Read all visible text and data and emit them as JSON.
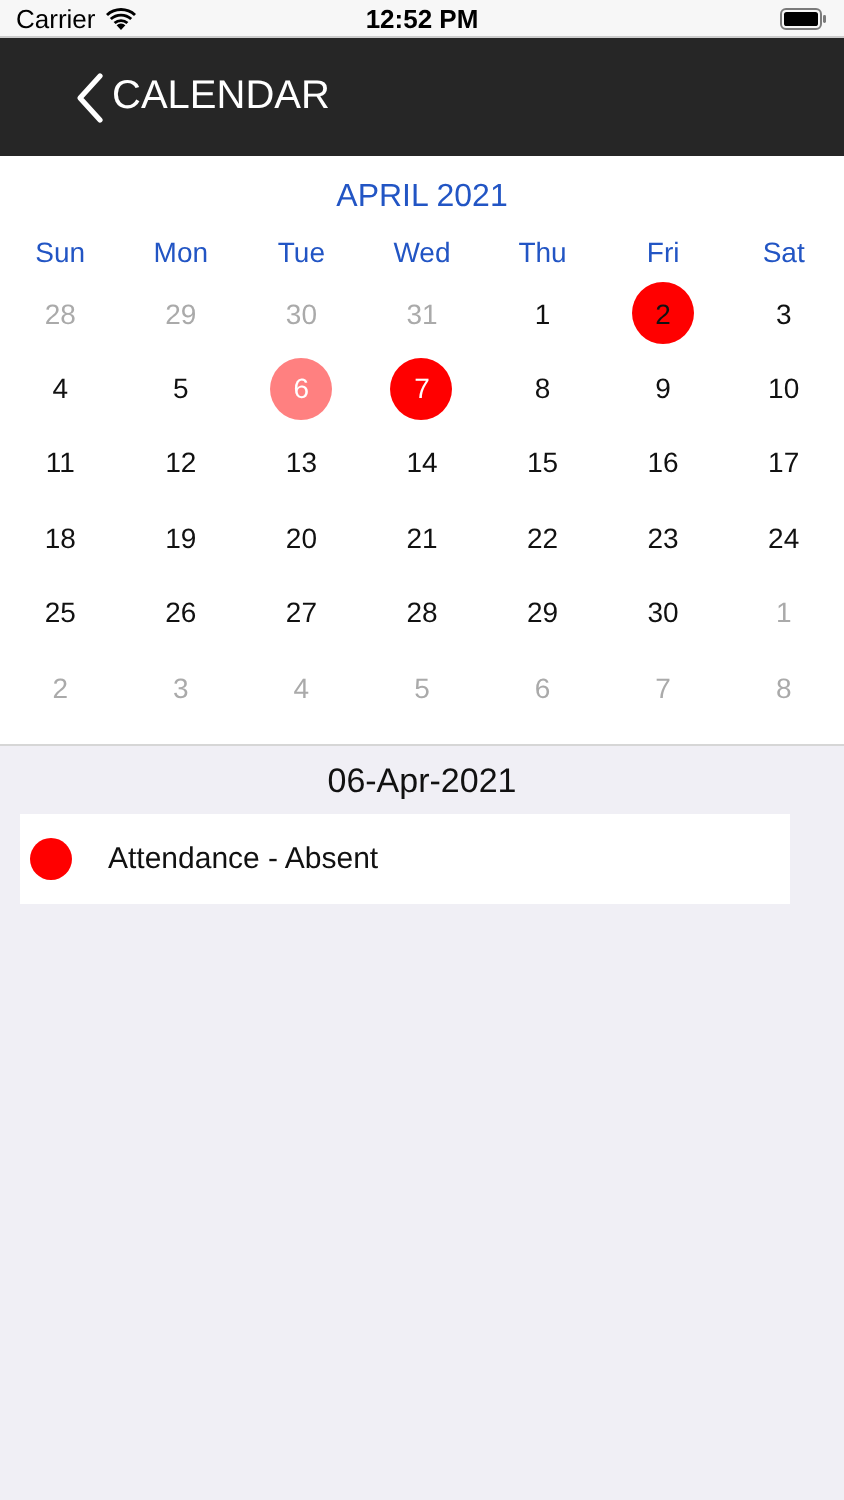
{
  "status_bar": {
    "carrier": "Carrier",
    "time": "12:52 PM"
  },
  "nav": {
    "title": "CALENDAR"
  },
  "calendar": {
    "month": "APRIL 2021",
    "weekdays": [
      "Sun",
      "Mon",
      "Tue",
      "Wed",
      "Thu",
      "Fri",
      "Sat"
    ],
    "weeks": [
      [
        {
          "day": "28",
          "kind": "plain",
          "in_month": false,
          "selected": false
        },
        {
          "day": "29",
          "kind": "plain",
          "in_month": false,
          "selected": false
        },
        {
          "day": "30",
          "kind": "plain",
          "in_month": false,
          "selected": false
        },
        {
          "day": "31",
          "kind": "plain",
          "in_month": false,
          "selected": false
        },
        {
          "day": "1",
          "kind": "plain",
          "in_month": true,
          "selected": false
        },
        {
          "day": "2",
          "kind": "today",
          "in_month": true,
          "selected": false,
          "color": "#ff0000"
        },
        {
          "day": "3",
          "kind": "plain",
          "in_month": true,
          "selected": false
        }
      ],
      [
        {
          "day": "4",
          "kind": "plain",
          "in_month": true,
          "selected": false
        },
        {
          "day": "5",
          "kind": "plain",
          "in_month": true,
          "selected": false
        },
        {
          "day": "6",
          "kind": "plain",
          "in_month": true,
          "selected": true
        },
        {
          "day": "7",
          "kind": "event",
          "in_month": true,
          "selected": false,
          "color": "#ff0000"
        },
        {
          "day": "8",
          "kind": "plain",
          "in_month": true,
          "selected": false
        },
        {
          "day": "9",
          "kind": "plain",
          "in_month": true,
          "selected": false
        },
        {
          "day": "10",
          "kind": "plain",
          "in_month": true,
          "selected": false
        }
      ],
      [
        {
          "day": "11",
          "kind": "plain",
          "in_month": true,
          "selected": false
        },
        {
          "day": "12",
          "kind": "plain",
          "in_month": true,
          "selected": false
        },
        {
          "day": "13",
          "kind": "plain",
          "in_month": true,
          "selected": false
        },
        {
          "day": "14",
          "kind": "plain",
          "in_month": true,
          "selected": false
        },
        {
          "day": "15",
          "kind": "plain",
          "in_month": true,
          "selected": false
        },
        {
          "day": "16",
          "kind": "plain",
          "in_month": true,
          "selected": false
        },
        {
          "day": "17",
          "kind": "plain",
          "in_month": true,
          "selected": false
        }
      ],
      [
        {
          "day": "18",
          "kind": "plain",
          "in_month": true,
          "selected": false
        },
        {
          "day": "19",
          "kind": "plain",
          "in_month": true,
          "selected": false
        },
        {
          "day": "20",
          "kind": "plain",
          "in_month": true,
          "selected": false
        },
        {
          "day": "21",
          "kind": "plain",
          "in_month": true,
          "selected": false
        },
        {
          "day": "22",
          "kind": "plain",
          "in_month": true,
          "selected": false
        },
        {
          "day": "23",
          "kind": "plain",
          "in_month": true,
          "selected": false
        },
        {
          "day": "24",
          "kind": "plain",
          "in_month": true,
          "selected": false
        }
      ],
      [
        {
          "day": "25",
          "kind": "plain",
          "in_month": true,
          "selected": false
        },
        {
          "day": "26",
          "kind": "plain",
          "in_month": true,
          "selected": false
        },
        {
          "day": "27",
          "kind": "plain",
          "in_month": true,
          "selected": false
        },
        {
          "day": "28",
          "kind": "plain",
          "in_month": true,
          "selected": false
        },
        {
          "day": "29",
          "kind": "plain",
          "in_month": true,
          "selected": false
        },
        {
          "day": "30",
          "kind": "plain",
          "in_month": true,
          "selected": false
        },
        {
          "day": "1",
          "kind": "plain",
          "in_month": false,
          "selected": false
        }
      ],
      [
        {
          "day": "2",
          "kind": "plain",
          "in_month": false,
          "selected": false
        },
        {
          "day": "3",
          "kind": "plain",
          "in_month": false,
          "selected": false
        },
        {
          "day": "4",
          "kind": "plain",
          "in_month": false,
          "selected": false
        },
        {
          "day": "5",
          "kind": "plain",
          "in_month": false,
          "selected": false
        },
        {
          "day": "6",
          "kind": "plain",
          "in_month": false,
          "selected": false
        },
        {
          "day": "7",
          "kind": "plain",
          "in_month": false,
          "selected": false
        },
        {
          "day": "8",
          "kind": "plain",
          "in_month": false,
          "selected": false
        }
      ]
    ]
  },
  "selected_date": "06-Apr-2021",
  "events": [
    {
      "title": "Attendance - Absent",
      "color": "#ff0000"
    }
  ]
}
